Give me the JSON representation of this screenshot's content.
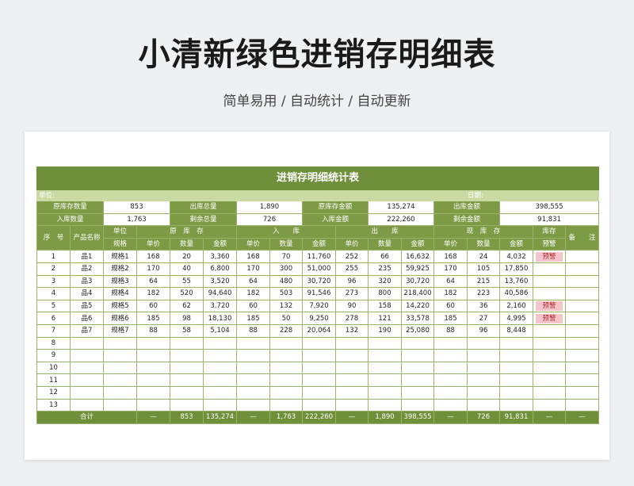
{
  "header": {
    "title": "小清新绿色进销存明细表",
    "subtitle": "简单易用 / 自动统计 / 自动更新"
  },
  "sheet": {
    "banner": "进销存明细统计表",
    "unit_label": "单位:",
    "date_label": "日期:",
    "summary": {
      "orig_qty_label": "原库存数量",
      "orig_qty": "853",
      "out_total_label": "出库总量",
      "out_total": "1,890",
      "orig_amt_label": "原库存金额",
      "orig_amt": "135,274",
      "out_amt_label": "出库金额",
      "out_amt": "398,555",
      "in_qty_label": "入库数量",
      "in_qty": "1,763",
      "remain_qty_label": "剩余总量",
      "remain_qty": "726",
      "in_amt_label": "入库金额",
      "in_amt": "222,260",
      "remain_amt_label": "剩余金额",
      "remain_amt": "91,831"
    },
    "headers": {
      "seq": "序　号",
      "name": "产品名称",
      "unit": "单位",
      "spec": "规格",
      "orig": "原　库　存",
      "in": "入　　库",
      "out": "出　　库",
      "now": "现　库　存",
      "alert_line1": "库存",
      "alert_line2": "预警",
      "note": "备　　注",
      "price": "单价",
      "qty": "数量",
      "amount": "金额"
    },
    "rows": [
      {
        "seq": "1",
        "name": "品1",
        "spec": "规格1",
        "op": "168",
        "oq": "20",
        "oa": "3,360",
        "ip": "168",
        "iq": "70",
        "ia": "11,760",
        "xp": "252",
        "xq": "66",
        "xa": "16,632",
        "np": "168",
        "nq": "24",
        "na": "4,032",
        "alert": "预警",
        "note": ""
      },
      {
        "seq": "2",
        "name": "品2",
        "spec": "规格2",
        "op": "170",
        "oq": "40",
        "oa": "6,800",
        "ip": "170",
        "iq": "300",
        "ia": "51,000",
        "xp": "255",
        "xq": "235",
        "xa": "59,925",
        "np": "170",
        "nq": "105",
        "na": "17,850",
        "alert": "",
        "note": ""
      },
      {
        "seq": "3",
        "name": "品3",
        "spec": "规格3",
        "op": "64",
        "oq": "55",
        "oa": "3,520",
        "ip": "64",
        "iq": "480",
        "ia": "30,720",
        "xp": "96",
        "xq": "320",
        "xa": "30,720",
        "np": "64",
        "nq": "215",
        "na": "13,760",
        "alert": "",
        "note": ""
      },
      {
        "seq": "4",
        "name": "品4",
        "spec": "规格4",
        "op": "182",
        "oq": "520",
        "oa": "94,640",
        "ip": "182",
        "iq": "503",
        "ia": "91,546",
        "xp": "273",
        "xq": "800",
        "xa": "218,400",
        "np": "182",
        "nq": "223",
        "na": "40,586",
        "alert": "",
        "note": ""
      },
      {
        "seq": "5",
        "name": "品5",
        "spec": "规格5",
        "op": "60",
        "oq": "62",
        "oa": "3,720",
        "ip": "60",
        "iq": "132",
        "ia": "7,920",
        "xp": "90",
        "xq": "158",
        "xa": "14,220",
        "np": "60",
        "nq": "36",
        "na": "2,160",
        "alert": "预警",
        "note": ""
      },
      {
        "seq": "6",
        "name": "品6",
        "spec": "规格6",
        "op": "185",
        "oq": "98",
        "oa": "18,130",
        "ip": "185",
        "iq": "50",
        "ia": "9,250",
        "xp": "278",
        "xq": "121",
        "xa": "33,578",
        "np": "185",
        "nq": "27",
        "na": "4,995",
        "alert": "预警",
        "note": ""
      },
      {
        "seq": "7",
        "name": "品7",
        "spec": "规格7",
        "op": "88",
        "oq": "58",
        "oa": "5,104",
        "ip": "88",
        "iq": "228",
        "ia": "20,064",
        "xp": "132",
        "xq": "190",
        "xa": "25,080",
        "np": "88",
        "nq": "96",
        "na": "8,448",
        "alert": "",
        "note": ""
      },
      {
        "seq": "8",
        "name": "",
        "spec": "",
        "op": "",
        "oq": "",
        "oa": "",
        "ip": "",
        "iq": "",
        "ia": "",
        "xp": "",
        "xq": "",
        "xa": "",
        "np": "",
        "nq": "",
        "na": "",
        "alert": "",
        "note": ""
      },
      {
        "seq": "9",
        "name": "",
        "spec": "",
        "op": "",
        "oq": "",
        "oa": "",
        "ip": "",
        "iq": "",
        "ia": "",
        "xp": "",
        "xq": "",
        "xa": "",
        "np": "",
        "nq": "",
        "na": "",
        "alert": "",
        "note": ""
      },
      {
        "seq": "10",
        "name": "",
        "spec": "",
        "op": "",
        "oq": "",
        "oa": "",
        "ip": "",
        "iq": "",
        "ia": "",
        "xp": "",
        "xq": "",
        "xa": "",
        "np": "",
        "nq": "",
        "na": "",
        "alert": "",
        "note": ""
      },
      {
        "seq": "11",
        "name": "",
        "spec": "",
        "op": "",
        "oq": "",
        "oa": "",
        "ip": "",
        "iq": "",
        "ia": "",
        "xp": "",
        "xq": "",
        "xa": "",
        "np": "",
        "nq": "",
        "na": "",
        "alert": "",
        "note": ""
      },
      {
        "seq": "12",
        "name": "",
        "spec": "",
        "op": "",
        "oq": "",
        "oa": "",
        "ip": "",
        "iq": "",
        "ia": "",
        "xp": "",
        "xq": "",
        "xa": "",
        "np": "",
        "nq": "",
        "na": "",
        "alert": "",
        "note": ""
      },
      {
        "seq": "13",
        "name": "",
        "spec": "",
        "op": "",
        "oq": "",
        "oa": "",
        "ip": "",
        "iq": "",
        "ia": "",
        "xp": "",
        "xq": "",
        "xa": "",
        "np": "",
        "nq": "",
        "na": "",
        "alert": "",
        "note": ""
      }
    ],
    "totals": {
      "label": "合计",
      "op": "—",
      "oq": "853",
      "oa": "135,274",
      "ip": "—",
      "iq": "1,763",
      "ia": "222,260",
      "xp": "—",
      "xq": "1,890",
      "xa": "398,555",
      "np": "—",
      "nq": "726",
      "na": "91,831",
      "alert": "—",
      "note": "—"
    }
  },
  "colors": {
    "banner_green": "#6f8f3a",
    "header_green": "#7d9a45",
    "light_green": "#c9dba3",
    "alert_bg": "#f4c6cc",
    "alert_text": "#b0272f"
  }
}
